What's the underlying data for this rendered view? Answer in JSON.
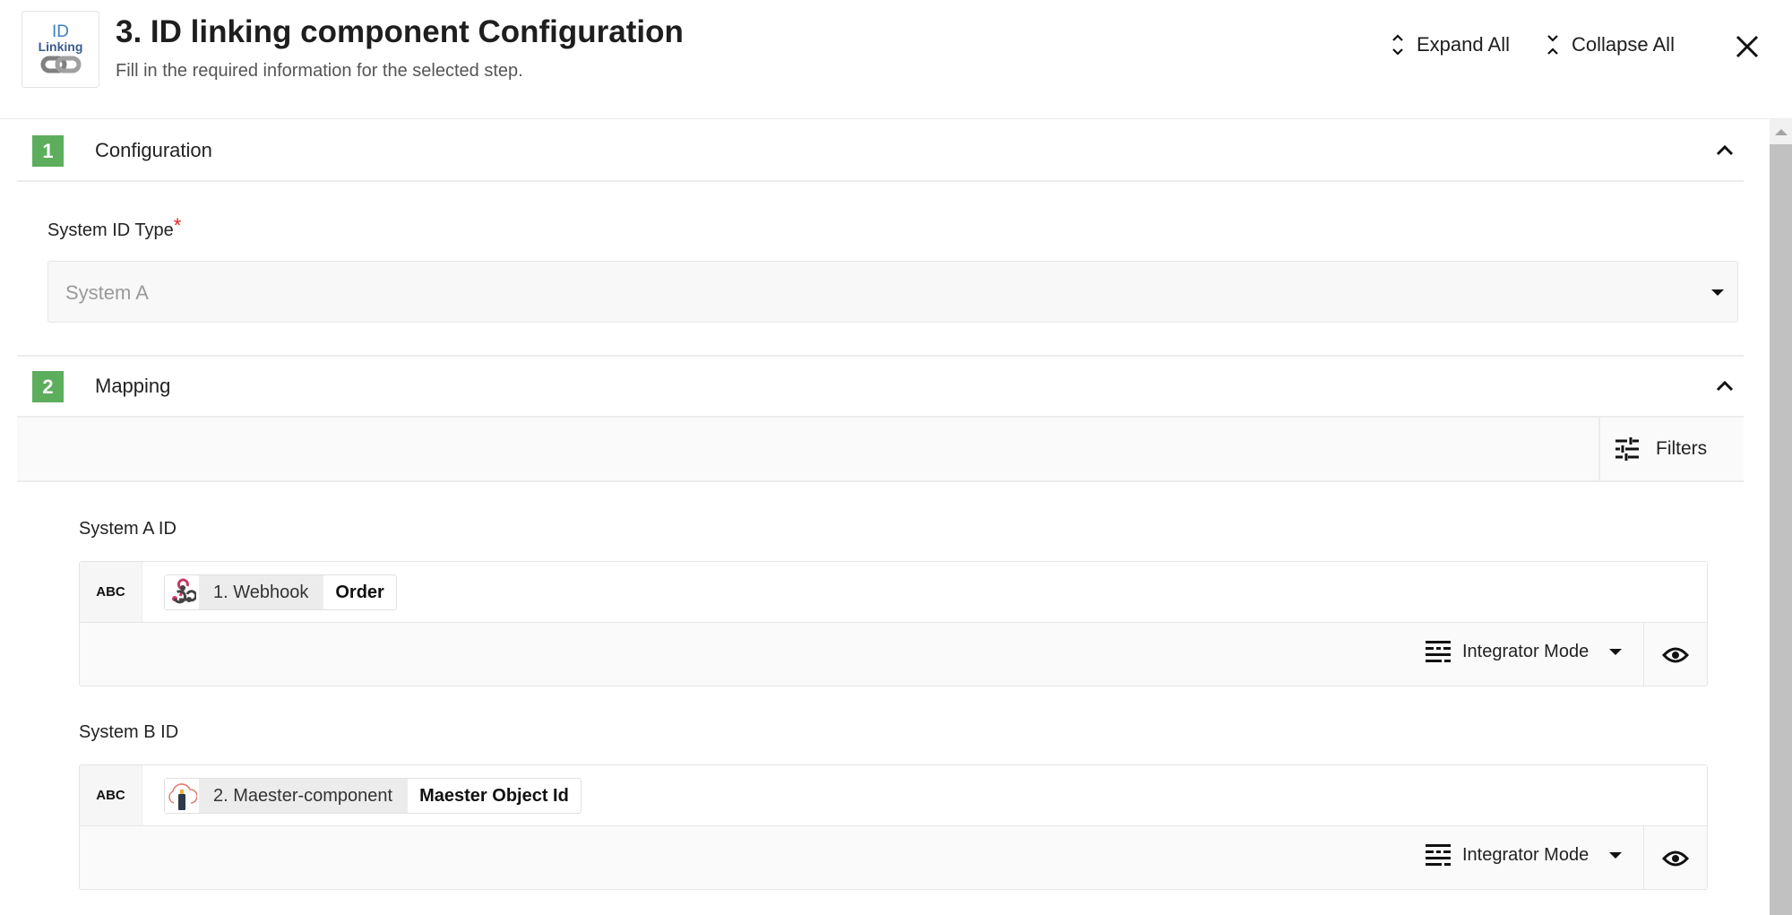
{
  "header": {
    "logo": {
      "line1": "ID",
      "line2": "Linking"
    },
    "title": "3. ID linking component Configuration",
    "subtitle": "Fill in the required information for the selected step.",
    "expand_all": "Expand All",
    "collapse_all": "Collapse All"
  },
  "sections": [
    {
      "number": "1",
      "title": "Configuration",
      "fields": [
        {
          "label": "System ID Type",
          "required_mark": "*",
          "value": "System A"
        }
      ]
    },
    {
      "number": "2",
      "title": "Mapping",
      "filters_label": "Filters",
      "mappings": [
        {
          "label": "System A ID",
          "type_badge": "ABC",
          "source_step": "1. Webhook",
          "source_field": "Order",
          "source_icon": "webhook-icon",
          "mode": "Integrator Mode"
        },
        {
          "label": "System B ID",
          "type_badge": "ABC",
          "source_step": "2. Maester-component",
          "source_field": "Maester Object Id",
          "source_icon": "cloud-usb-icon",
          "mode": "Integrator Mode"
        }
      ]
    }
  ],
  "colors": {
    "step_badge": "#5cae5c",
    "required": "#e02020",
    "webhook_accent": "#c73a63"
  }
}
